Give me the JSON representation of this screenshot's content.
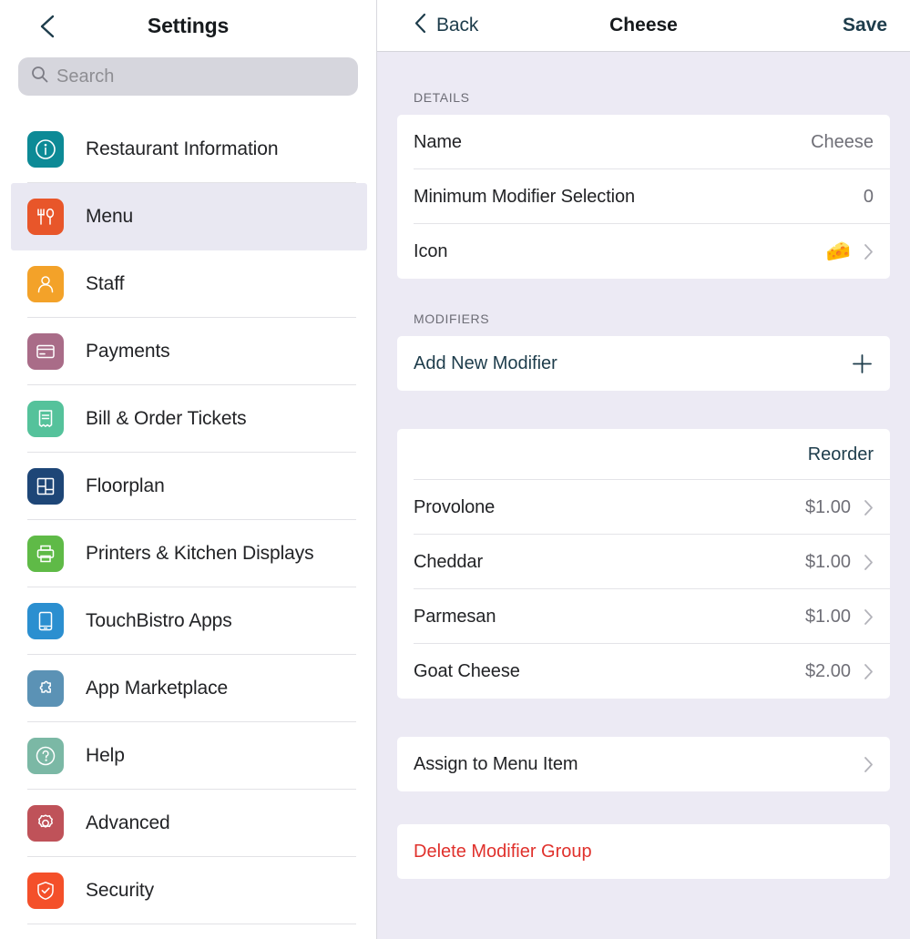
{
  "sidebar": {
    "back_icon": "chevron-left-icon",
    "title": "Settings",
    "search": {
      "icon": "search-icon",
      "placeholder": "Search",
      "value": ""
    },
    "items": [
      {
        "label": "Restaurant Information",
        "icon": "info-icon",
        "color": "#0d8a96",
        "selected": false
      },
      {
        "label": "Menu",
        "icon": "cutlery-icon",
        "color": "#e8562a",
        "selected": true
      },
      {
        "label": "Staff",
        "icon": "person-icon",
        "color": "#f3a229",
        "selected": false
      },
      {
        "label": "Payments",
        "icon": "credit-card-icon",
        "color": "#a96c88",
        "selected": false
      },
      {
        "label": "Bill & Order Tickets",
        "icon": "receipt-icon",
        "color": "#55c29b",
        "selected": false
      },
      {
        "label": "Floorplan",
        "icon": "floorplan-icon",
        "color": "#1e4677",
        "selected": false
      },
      {
        "label": "Printers & Kitchen Displays",
        "icon": "printer-icon",
        "color": "#5fba47",
        "selected": false
      },
      {
        "label": "TouchBistro Apps",
        "icon": "tablet-icon",
        "color": "#2b8fd0",
        "selected": false
      },
      {
        "label": "App Marketplace",
        "icon": "puzzle-icon",
        "color": "#5b92b5",
        "selected": false
      },
      {
        "label": "Help",
        "icon": "question-icon",
        "color": "#7bb8a5",
        "selected": false
      },
      {
        "label": "Advanced",
        "icon": "gear-icon",
        "color": "#bf5259",
        "selected": false
      },
      {
        "label": "Security",
        "icon": "shield-check-icon",
        "color": "#f4502a",
        "selected": false
      }
    ]
  },
  "detail": {
    "back_icon": "chevron-left-icon",
    "back_label": "Back",
    "title": "Cheese",
    "save_label": "Save",
    "details_section": {
      "header": "DETAILS",
      "rows": [
        {
          "label": "Name",
          "value": "Cheese",
          "chevron": false
        },
        {
          "label": "Minimum Modifier Selection",
          "value": "0",
          "chevron": false
        },
        {
          "label": "Icon",
          "value": "🧀",
          "chevron": true
        }
      ]
    },
    "modifiers_section": {
      "header": "MODIFIERS",
      "add_label": "Add New Modifier",
      "add_icon": "plus-icon",
      "reorder_label": "Reorder",
      "items": [
        {
          "name": "Provolone",
          "price": "$1.00"
        },
        {
          "name": "Cheddar",
          "price": "$1.00"
        },
        {
          "name": "Parmesan",
          "price": "$1.00"
        },
        {
          "name": "Goat Cheese",
          "price": "$2.00"
        }
      ]
    },
    "assign_label": "Assign to Menu Item",
    "delete_label": "Delete Modifier Group"
  },
  "colors": {
    "accent_teal": "#1d3c4b",
    "destructive_red": "#e0312c",
    "panel_background": "#eceaf4",
    "selected_row": "#e9e8f2"
  }
}
